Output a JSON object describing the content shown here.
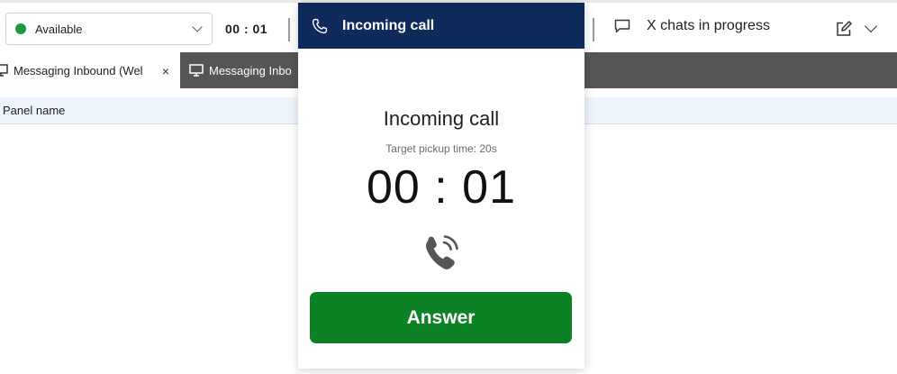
{
  "toolbar": {
    "status": {
      "label": "Available",
      "color": "#1a9c3e"
    },
    "timer": "00 : 01",
    "chats_label": "X chats in progress"
  },
  "tabs": [
    {
      "label": "Messaging Inbound (Wel",
      "close": "×",
      "icon": "monitor-icon"
    },
    {
      "label": "Messaging Inbo",
      "icon": "monitor-icon"
    }
  ],
  "panel": {
    "header": "Panel name"
  },
  "popup": {
    "title": "Incoming call",
    "heading": "Incoming call",
    "pickup_target": "Target pickup time: 20s",
    "timer": "00 : 01",
    "answer_label": "Answer",
    "colors": {
      "header": "#0d2a5b",
      "answer": "#0d8125"
    }
  }
}
